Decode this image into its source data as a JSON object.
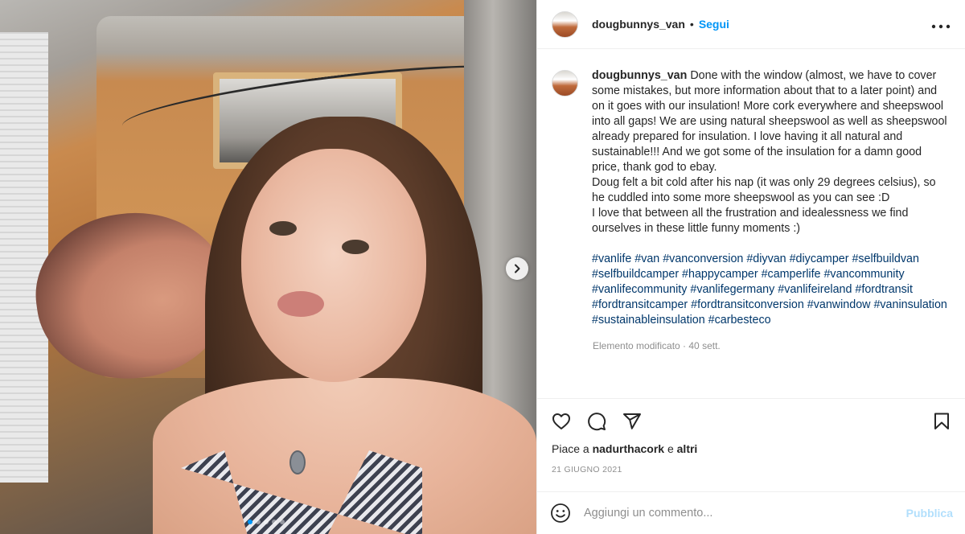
{
  "post": {
    "username": "dougbunnys_van",
    "bullet": "•",
    "follow_label": "Segui",
    "more_label": "•••",
    "caption_user": "dougbunnys_van",
    "caption_text": "Done with the window (almost, we have to cover some mistakes, but more information about that to a later point) and on it goes with our insulation! More cork everywhere and sheepswool into all gaps! We are using natural sheepswool as well as sheepswool already prepared for insulation. I love having it all natural and sustainable!!! And we got some of the insulation for a damn good price, thank god to ebay.\nDoug felt a bit cold after his nap (it was only 29 degrees celsius), so he cuddled into some more sheepswool as you can see :D\nI love that between all the frustration and idealessness we find ourselves in these little funny moments :)",
    "hashtags": "#vanlife #van #vanconversion #diyvan #diycamper #selfbuildvan #selfbuildcamper #happycamper #camperlife #vancommunity #vanlifecommunity #vanlifegermany #vanlifeireland #fordtransit #fordtransitcamper #fordtransitconversion #vanwindow #vaninsulation #sustainableinsulation #carbesteco",
    "meta": "Elemento modificato · 40 sett.",
    "likes_prefix": "Piace a ",
    "likes_user": "nadurthacork",
    "likes_mid": " e ",
    "likes_others": "altri",
    "date": "21 giugno 2021"
  },
  "media": {
    "slides_total": 5,
    "active_slide": 1
  },
  "comment_box": {
    "placeholder": "Aggiungi un commento...",
    "publish_label": "Pubblica"
  },
  "colors": {
    "accent": "#0095f6",
    "hashtag": "#00376b",
    "muted": "#8e8e8e",
    "publish_disabled": "#b2dffc"
  },
  "icons": {
    "like": "heart-icon",
    "comment": "comment-icon",
    "share": "send-icon",
    "save": "bookmark-icon",
    "emoji": "emoji-icon",
    "next": "chevron-right-icon"
  }
}
